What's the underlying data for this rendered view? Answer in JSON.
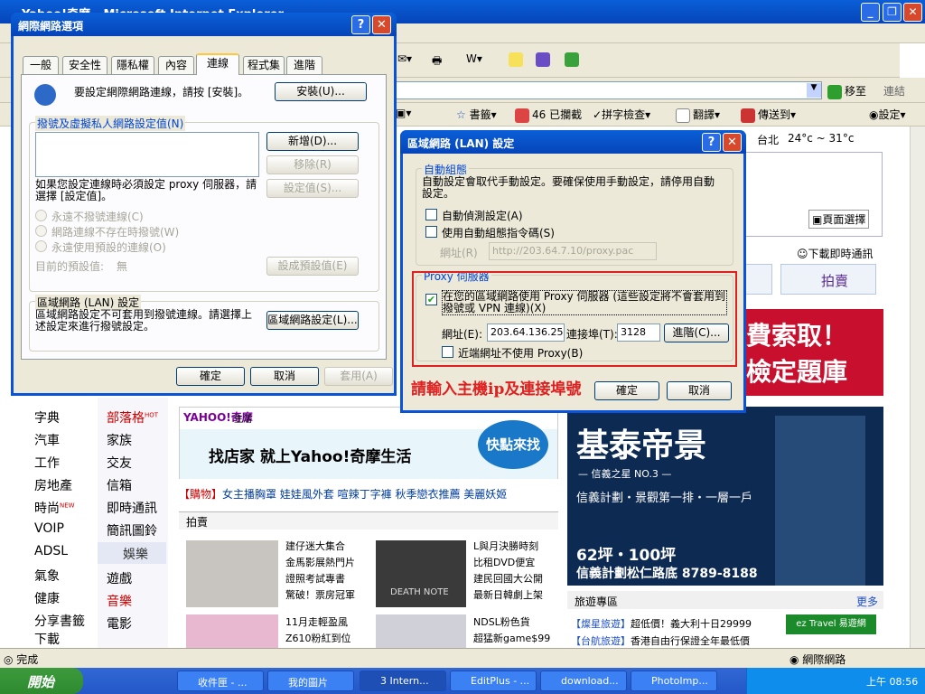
{
  "ie": {
    "title": "Yahoo!奇摩 - Microsoft Internet Explorer",
    "address_go": "移至",
    "address_links": "連結",
    "toolbar2": {
      "bookmarks": "書籤",
      "blocked": "46 已攔截",
      "spell": "拼字檢查",
      "translate": "翻譯",
      "send": "傳送到",
      "settings": "設定"
    },
    "status": "完成",
    "zone": "網際網路"
  },
  "page": {
    "weather": "台北",
    "temp": "24°c ~ 31°c",
    "page_select": "頁面選擇",
    "download_msg": "下載即時通訊",
    "auction_btn": "拍賣",
    "ad_banner1": "費索取！",
    "ad_banner2": "檢定題庫",
    "categories_left": [
      "字典",
      "汽車",
      "工作",
      "房地產",
      "時尚",
      "VOIP",
      "ADSL",
      "氣象",
      "健康",
      "分享書籤",
      "下載"
    ],
    "categories_right": [
      "部落格",
      "家族",
      "交友",
      "信箱",
      "即時通訊",
      "簡訊圖鈴"
    ],
    "categories_right2": [
      "遊戲",
      "音樂",
      "電影"
    ],
    "entertainment": "娛樂",
    "hot_tag": "HOT",
    "new_tag": "NEW",
    "yahoo_life_logo": "YAHOO!奇摩",
    "yahoo_life_sub": "生活",
    "yahoo_life_slogan": "找店家  就上Yahoo!奇摩生活",
    "quick_find": "快點來找",
    "shopping_tag": "【購物】",
    "shopping_links": "女主播胸罩  娃娃風外套  喧辣丁字褲  秋季戀衣推薦  美麗妖姬",
    "auction_section": "拍賣",
    "news1": [
      "建仔迷大集合",
      "金馬影展熱門片",
      "證照考試專書",
      "驚破！票房冠軍"
    ],
    "news2": [
      "L與月決勝時刻",
      "比租DVD便宜",
      "建民回國大公開",
      "最新日韓劇上架"
    ],
    "news3": [
      "11月走輕盈風",
      "Z610粉紅到位"
    ],
    "news4": [
      "NDSL粉色貨",
      "超猛新game$99"
    ],
    "death_note": "DEATH NOTE",
    "realestate_title": "基泰帝景",
    "realestate_sub": "— 信義之星 NO.3 —",
    "realestate_line": "信義計劃・景觀第一排・一層一戶",
    "realestate_size": "62坪・100坪",
    "realestate_phone": "信義計劃松仁路底 8789-8188",
    "travel_title": "旅遊專區",
    "travel_more": "更多",
    "travel1_tag": "【燦星旅遊】",
    "travel1": "超低價！義大利十日29999",
    "travel2_tag": "【台航旅遊】",
    "travel2": "香港自由行保證全年最低價",
    "eztravel": "ez Travel 易遊網"
  },
  "options": {
    "title": "網際網路選項",
    "tabs": [
      "一般",
      "安全性",
      "隱私權",
      "內容",
      "連線",
      "程式集",
      "進階"
    ],
    "active_tab": 4,
    "setup_text": "要設定網際網路連線，請按 [安裝]。",
    "setup_btn": "安裝(U)...",
    "dialup_group": "撥號及虛擬私人網路設定值(N)",
    "add_btn": "新增(D)...",
    "remove_btn": "移除(R)",
    "settings_btn": "設定值(S)...",
    "proxy_text": "如果您設定連線時必須設定 proxy 伺服器，請選擇 [設定值]。",
    "radio1": "永遠不撥號連線(C)",
    "radio2": "網路連線不存在時撥號(W)",
    "radio3": "永遠使用預設的連線(O)",
    "default_label": "目前的預設值:",
    "default_value": "無",
    "set_default_btn": "設成預設值(E)",
    "lan_group": "區域網路 (LAN) 設定",
    "lan_text": "區域網路設定不可套用到撥號連線。請選擇上述設定來進行撥號設定。",
    "lan_btn": "區域網路設定(L)...",
    "ok": "確定",
    "cancel": "取消",
    "apply": "套用(A)"
  },
  "lan": {
    "title": "區域網路 (LAN) 設定",
    "auto_group": "自動組態",
    "auto_text": "自動設定會取代手動設定。要確保使用手動設定，請停用自動設定。",
    "auto_detect": "自動偵測設定(A)",
    "auto_script": "使用自動組態指令碼(S)",
    "address_label": "網址(R)",
    "script_url": "http://203.64.7.10/proxy.pac",
    "proxy_group": "Proxy 伺服器",
    "proxy_check": "在您的區域網路使用 Proxy 伺服器 (這些設定將不會套用到撥號或 VPN 連線)(X)",
    "proxy_addr_label": "網址(E):",
    "proxy_addr": "203.64.136.250",
    "port_label": "連接埠(T):",
    "port": "3128",
    "advanced_btn": "進階(C)...",
    "bypass": "近端網址不使用 Proxy(B)",
    "ok": "確定",
    "cancel": "取消",
    "annotation": "請輸入主機ip及連接埠號"
  },
  "taskbar": {
    "start": "開始",
    "tasks": [
      "收件匣 - ...",
      "我的圖片",
      "3 Intern...",
      "EditPlus - ...",
      "download...",
      "PhotoImp..."
    ],
    "clock": "上午 08:56"
  },
  "colors": {
    "xp_blue": "#0a53d8",
    "highlight_red": "#e02020",
    "annotation_red": "#e02020",
    "yahoo_purple": "#7b0099"
  }
}
